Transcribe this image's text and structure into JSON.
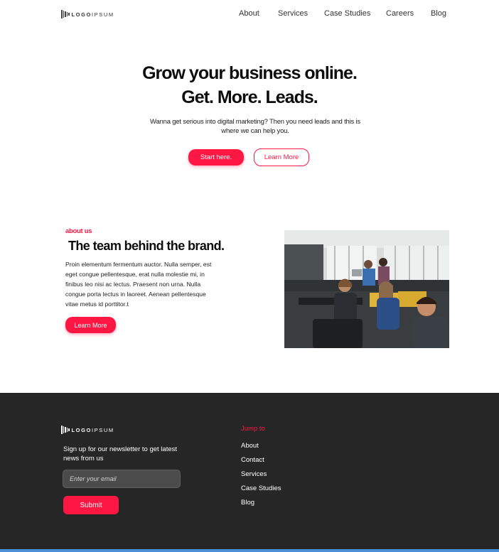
{
  "header": {
    "logo_bold": "LOGO",
    "logo_light": "IPSUM",
    "nav": [
      {
        "label": "About"
      },
      {
        "label": "Services"
      },
      {
        "label": "Case Studies"
      },
      {
        "label": "Careers"
      },
      {
        "label": "Blog"
      }
    ]
  },
  "hero": {
    "title_line1": "Grow your business online.",
    "title_line2": "Get. More. Leads.",
    "subtitle": "Wanna get serious into digital marketing? Then you need leads and this is where we can help you.",
    "primary_button": "Start here.",
    "secondary_button": "Learn More"
  },
  "about": {
    "eyebrow": "about us",
    "title": "The team behind the brand.",
    "body": "Proin elementum fermentum auctor. Nulla semper, est eget congue pellentesque, erat nulla molestie mi, in finibus leo nisi ac lectus. Praesent non urna. Nulla congue porta lectus in laoreet. Aenean pellentesque vitae metus id porttitor.t",
    "button": "Learn More"
  },
  "footer": {
    "logo_bold": "LOGO",
    "logo_light": "IPSUM",
    "newsletter_text": "Sign up for our newsletter to get latest news from us",
    "email_placeholder": "Enter your email",
    "submit_label": "Submit",
    "jump_title": "Jump to",
    "links": [
      {
        "label": "About"
      },
      {
        "label": "Contact"
      },
      {
        "label": "Services"
      },
      {
        "label": "Case Studies"
      },
      {
        "label": "Blog"
      }
    ]
  },
  "colors": {
    "accent": "#ff1744",
    "footer_bg": "#262626",
    "text": "#0d0d0d"
  }
}
